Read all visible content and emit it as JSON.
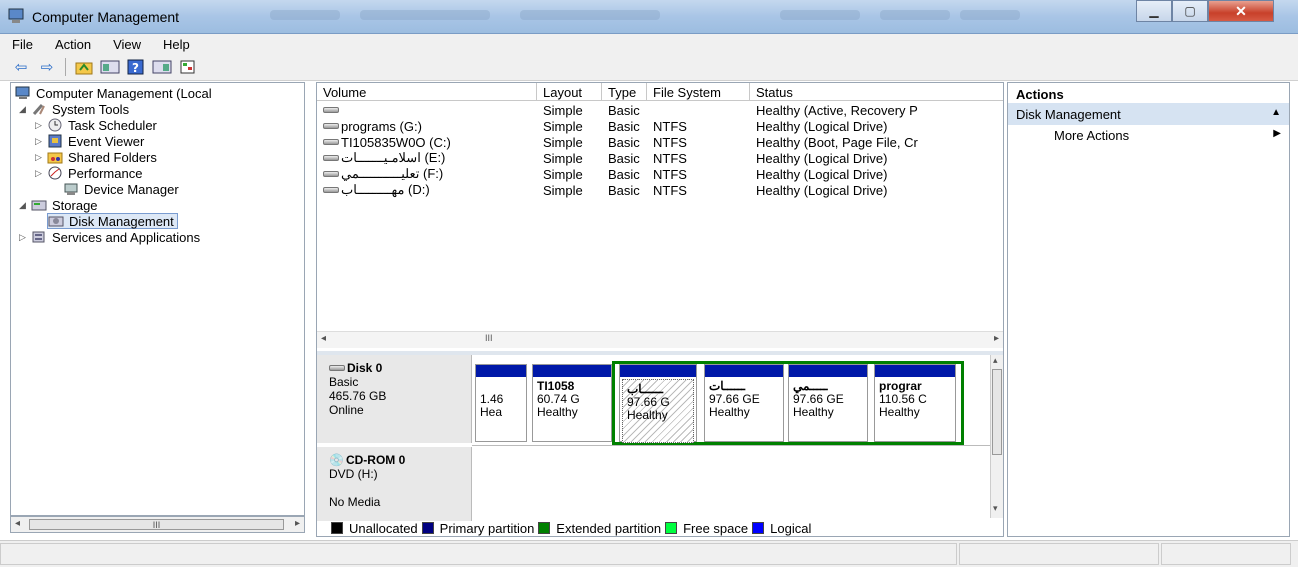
{
  "window": {
    "title": "Computer Management"
  },
  "menu": [
    "File",
    "Action",
    "View",
    "Help"
  ],
  "tree": {
    "root": "Computer Management (Local",
    "system_tools": "System Tools",
    "task_scheduler": "Task Scheduler",
    "event_viewer": "Event Viewer",
    "shared_folders": "Shared Folders",
    "performance": "Performance",
    "device_manager": "Device Manager",
    "storage": "Storage",
    "disk_management": "Disk Management",
    "services": "Services and Applications",
    "scroll_mark": "III"
  },
  "volumes": {
    "headers": [
      "Volume",
      "Layout",
      "Type",
      "File System",
      "Status"
    ],
    "rows": [
      {
        "volume": "",
        "layout": "Simple",
        "type": "Basic",
        "fs": "",
        "status": "Healthy (Active, Recovery P"
      },
      {
        "volume": "programs (G:)",
        "layout": "Simple",
        "type": "Basic",
        "fs": "NTFS",
        "status": "Healthy (Logical Drive)"
      },
      {
        "volume": "TI105835W0O (C:)",
        "layout": "Simple",
        "type": "Basic",
        "fs": "NTFS",
        "status": "Healthy (Boot, Page File, Cr"
      },
      {
        "volume": "اسلامـيـــــــات (E:)",
        "layout": "Simple",
        "type": "Basic",
        "fs": "NTFS",
        "status": "Healthy (Logical Drive)"
      },
      {
        "volume": "تعليـــــــــــمي (F:)",
        "layout": "Simple",
        "type": "Basic",
        "fs": "NTFS",
        "status": "Healthy (Logical Drive)"
      },
      {
        "volume": "مهـــــــــاب (D:)",
        "layout": "Simple",
        "type": "Basic",
        "fs": "NTFS",
        "status": "Healthy (Logical Drive)"
      }
    ],
    "scroll_mark": "III"
  },
  "disks": {
    "disk0": {
      "name": "Disk 0",
      "kind": "Basic",
      "size": "465.76 GB",
      "state": "Online"
    },
    "cdrom": {
      "name": "CD-ROM 0",
      "drive": "DVD (H:)",
      "media": "No Media"
    },
    "partitions": [
      {
        "name": "",
        "size": "1.46",
        "status": "Hea"
      },
      {
        "name": "TI1058",
        "size": "60.74 G",
        "status": "Healthy"
      },
      {
        "name": "ــــــاب",
        "size": "97.66 G",
        "status": "Healthy"
      },
      {
        "name": "ــــــات",
        "size": "97.66 GE",
        "status": "Healthy"
      },
      {
        "name": "ـــــمي",
        "size": "97.66 GE",
        "status": "Healthy"
      },
      {
        "name": "prograr",
        "size": "110.56 C",
        "status": "Healthy"
      }
    ]
  },
  "legend": [
    "Unallocated",
    "Primary partition",
    "Extended partition",
    "Free space",
    "Logical"
  ],
  "legend_colors": [
    "#000000",
    "#000080",
    "#008000",
    "#00ff40",
    "#0000ff"
  ],
  "actions": {
    "header": "Actions",
    "section": "Disk Management",
    "more": "More Actions"
  }
}
